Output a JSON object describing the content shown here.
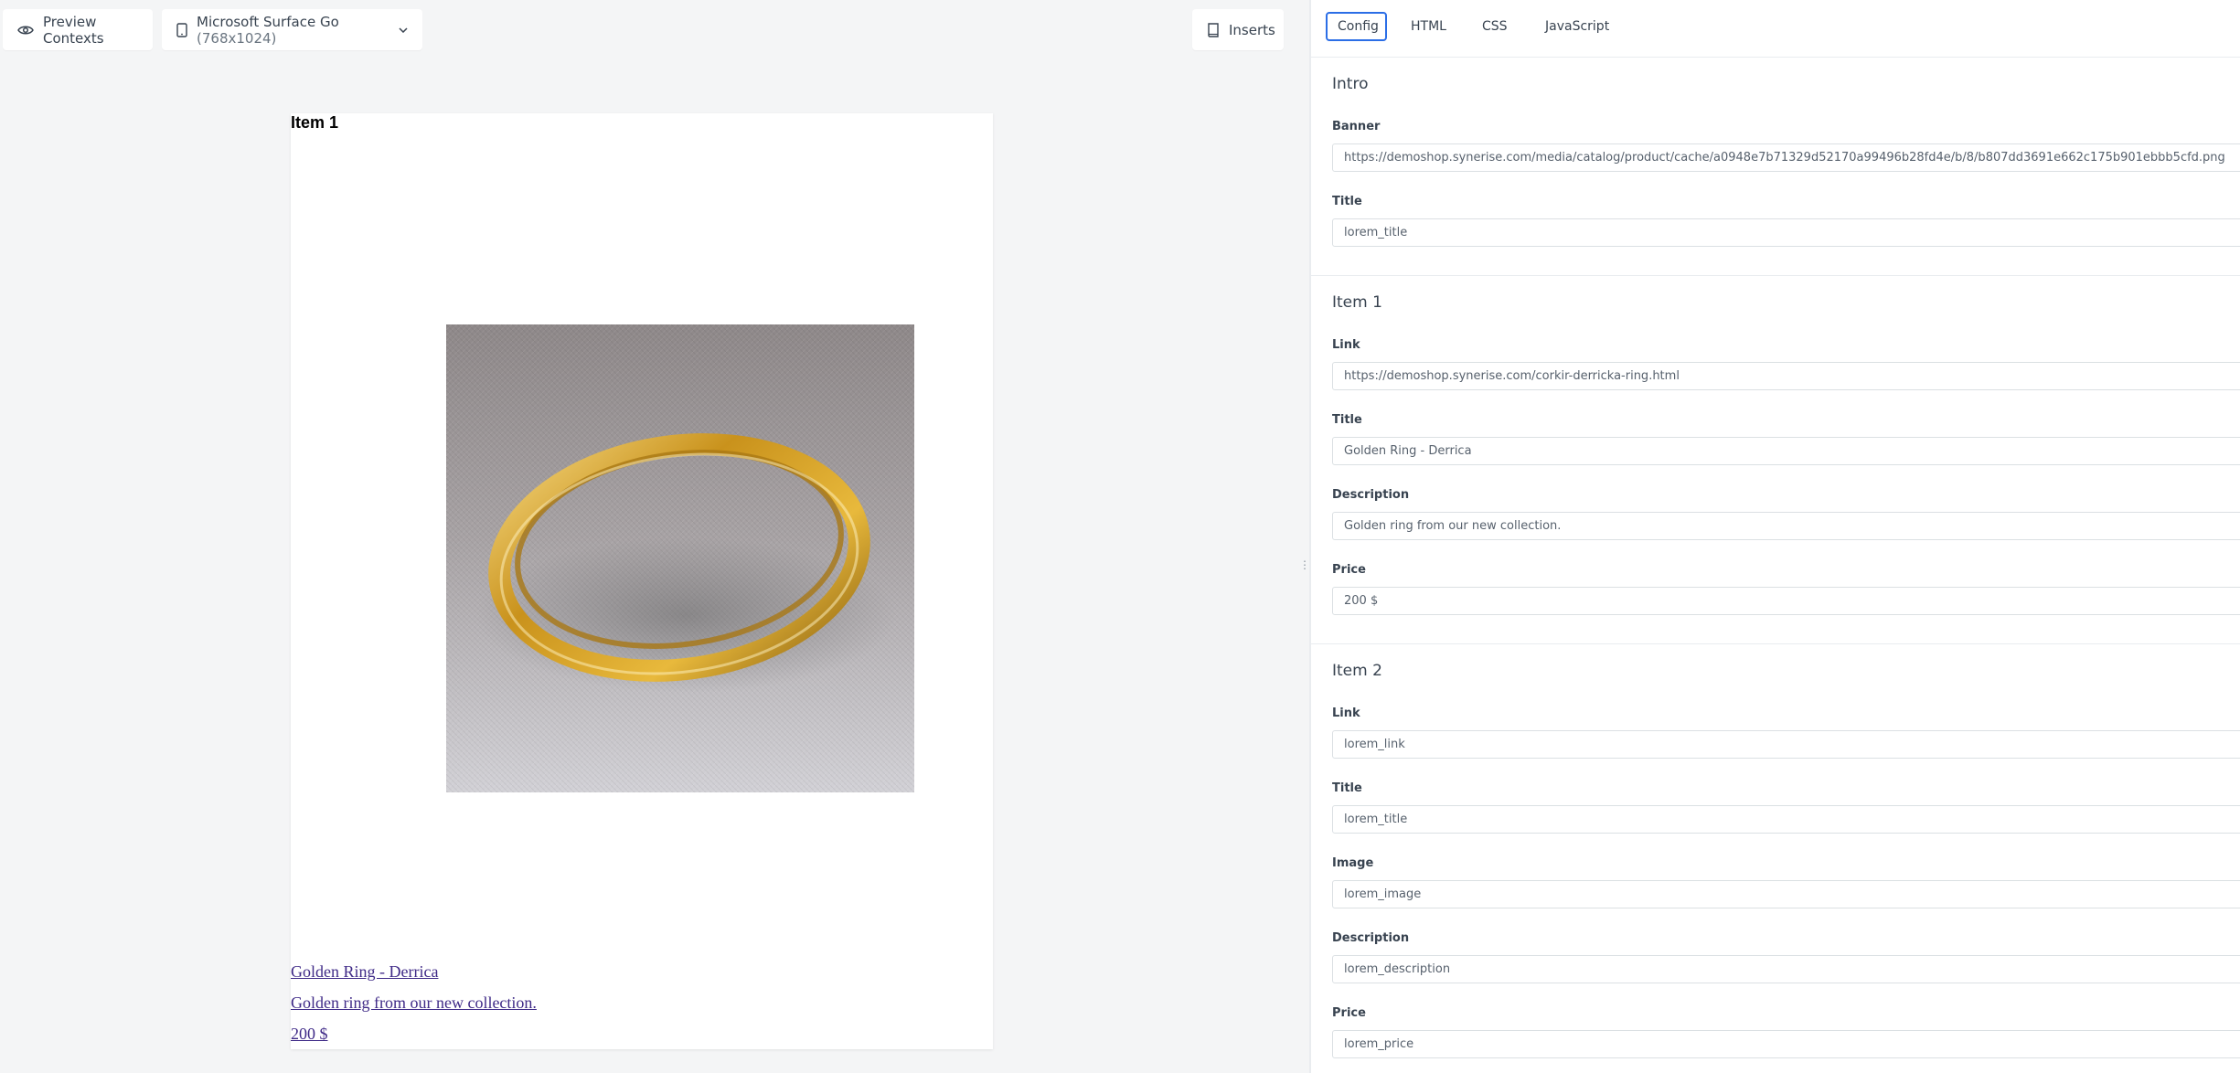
{
  "toolbar": {
    "preview_contexts_label": "Preview Contexts",
    "device_name": "Microsoft Surface Go",
    "device_resolution": "(768x1024)",
    "inserts_label": "Inserts"
  },
  "preview": {
    "heading": "Item 1",
    "link_title": "Golden Ring - Derrica",
    "link_description": "Golden ring from our new collection.",
    "link_price": "200 $"
  },
  "tabs": {
    "config": "Config",
    "html": "HTML",
    "css": "CSS",
    "javascript": "JavaScript"
  },
  "sections": {
    "intro": {
      "title": "Intro",
      "banner_label": "Banner",
      "banner_value": "https://demoshop.synerise.com/media/catalog/product/cache/a0948e7b71329d52170a99496b28fd4e/b/8/b807dd3691e662c175b901ebbb5cfd.png",
      "title_label": "Title",
      "title_value": "lorem_title"
    },
    "item1": {
      "title": "Item 1",
      "link_label": "Link",
      "link_value": "https://demoshop.synerise.com/corkir-derricka-ring.html",
      "title_label": "Title",
      "title_value": "Golden Ring - Derrica",
      "description_label": "Description",
      "description_value": "Golden ring from our new collection.",
      "price_label": "Price",
      "price_value": "200 $"
    },
    "item2": {
      "title": "Item 2",
      "link_label": "Link",
      "link_value": "lorem_link",
      "title_label": "Title",
      "title_value": "lorem_title",
      "image_label": "Image",
      "image_value": "lorem_image",
      "description_label": "Description",
      "description_value": "lorem_description",
      "price_label": "Price",
      "price_value": "lorem_price"
    }
  },
  "colors": {
    "accent": "#2b6ee6",
    "link": "#3f2a87",
    "ring_gold": "#d7a62b",
    "fabric": "#9e9899"
  },
  "icons": {
    "preview": "eye-icon",
    "device": "tablet-icon",
    "dropdown": "chevron-down-icon",
    "inserts": "book-icon",
    "splitter": "drag-handle-icon"
  }
}
